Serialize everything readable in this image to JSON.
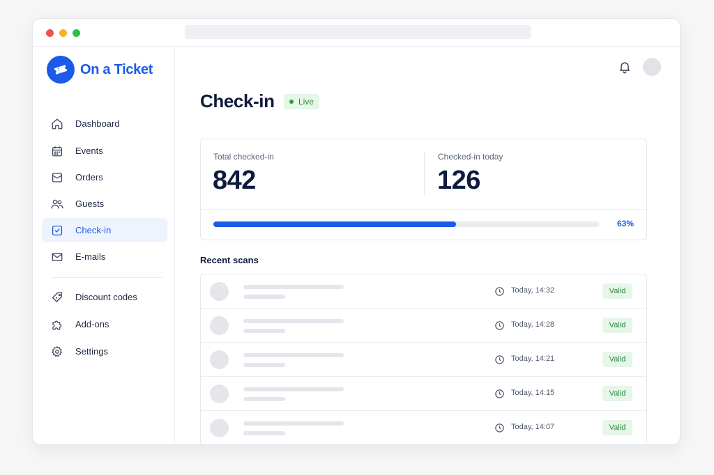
{
  "app": {
    "name": "On a Ticket",
    "brand_color": "#1a5be8",
    "logo_icon": "ticket-icon"
  },
  "sidebar": {
    "items": [
      {
        "label": "Dashboard",
        "icon": "home-icon",
        "active": false
      },
      {
        "label": "Events",
        "icon": "calendar-icon",
        "active": false
      },
      {
        "label": "Orders",
        "icon": "inbox-icon",
        "active": false
      },
      {
        "label": "Guests",
        "icon": "users-icon",
        "active": false
      },
      {
        "label": "Check-in",
        "icon": "check-square-icon",
        "active": true
      },
      {
        "label": "E-mails",
        "icon": "mail-icon",
        "active": false
      },
      {
        "label": "Discount codes",
        "icon": "tag-icon",
        "active": false
      },
      {
        "label": "Add-ons",
        "icon": "puzzle-icon",
        "active": false
      },
      {
        "label": "Settings",
        "icon": "gear-icon",
        "active": false
      }
    ]
  },
  "header": {
    "notifications_icon": "bell-icon"
  },
  "page": {
    "title": "Check-in",
    "status_badge": "Live",
    "status_color": "#2d9b43"
  },
  "stats": {
    "total_label": "Total checked-in",
    "total_value": "842",
    "today_label": "Checked-in today",
    "today_value": "126",
    "progress_label": "63%",
    "progress_fraction": 0.63
  },
  "recent_scans": {
    "title": "Recent scans",
    "rows": [
      {
        "time": "Today, 14:32",
        "status": "Valid"
      },
      {
        "time": "Today, 14:28",
        "status": "Valid"
      },
      {
        "time": "Today, 14:21",
        "status": "Valid"
      },
      {
        "time": "Today, 14:15",
        "status": "Valid"
      },
      {
        "time": "Today, 14:07",
        "status": "Valid"
      }
    ]
  }
}
